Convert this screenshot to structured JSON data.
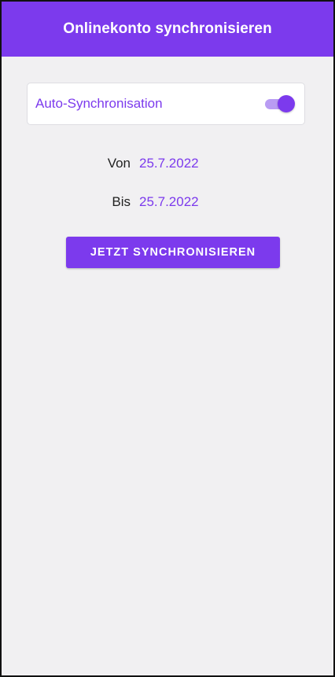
{
  "app_bar": {
    "title": "Onlinekonto synchronisieren"
  },
  "auto_sync": {
    "label": "Auto-Synchronisation",
    "enabled": true
  },
  "date_range": {
    "from_label": "Von",
    "from_value": "25.7.2022",
    "to_label": "Bis",
    "to_value": "25.7.2022"
  },
  "actions": {
    "sync_now_label": "JETZT SYNCHRONISIEREN"
  },
  "colors": {
    "accent": "#7c3aed",
    "accent_light": "#b99cf3",
    "background": "#f1f0f2",
    "surface": "#ffffff"
  }
}
